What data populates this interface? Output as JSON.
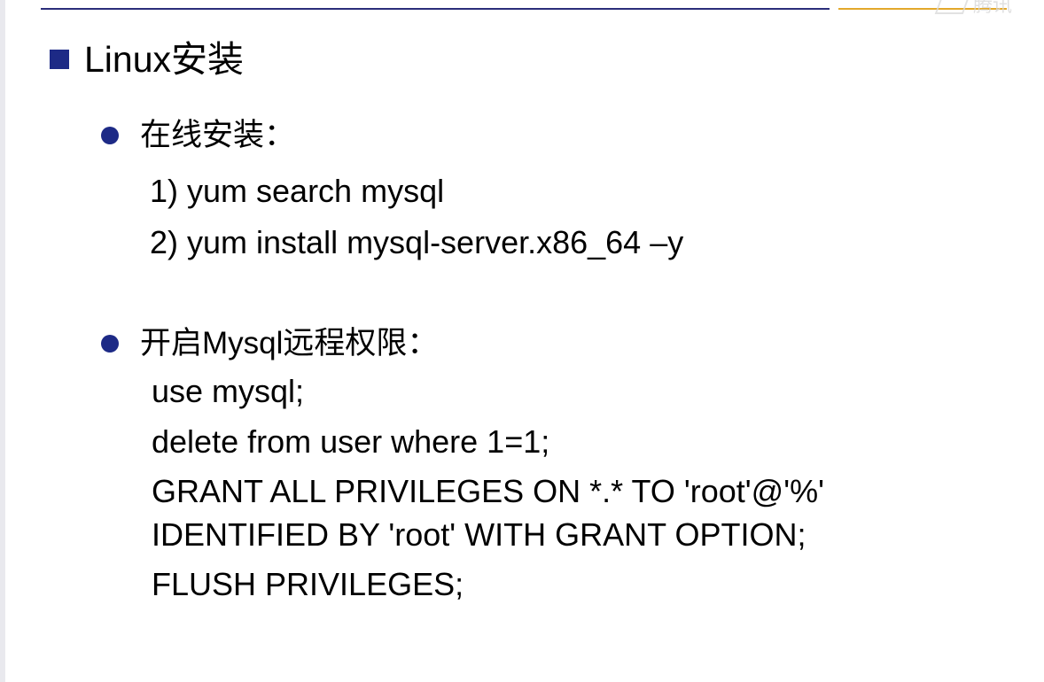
{
  "heading": "Linux安装",
  "watermark": "腾讯",
  "section_online": {
    "label": "在线安装：",
    "steps": [
      "1) yum search mysql",
      "2) yum install mysql-server.x86_64 –y"
    ]
  },
  "section_remote": {
    "label": "开启Mysql远程权限：",
    "lines": [
      "use mysql;",
      "delete from user where 1=1;",
      "GRANT ALL PRIVILEGES ON *.* TO 'root'@'%'",
      "IDENTIFIED BY 'root' WITH GRANT OPTION;",
      "FLUSH PRIVILEGES;"
    ]
  },
  "colors": {
    "accent_blue": "#1d2a86",
    "accent_gold": "#e3a82b"
  }
}
